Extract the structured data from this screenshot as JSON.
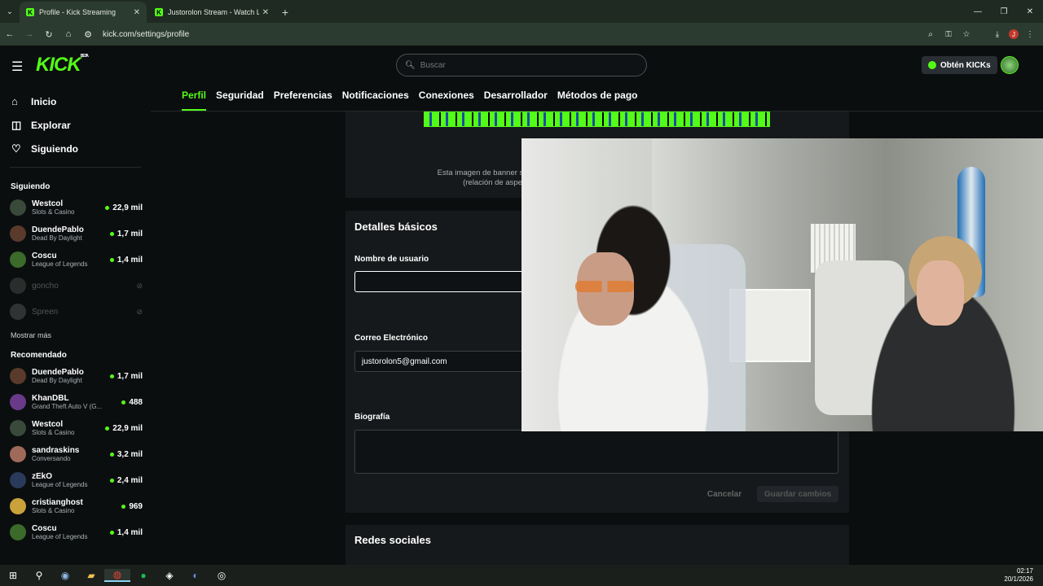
{
  "browser": {
    "tabs": [
      {
        "title": "Profile - Kick Streaming",
        "active": true
      },
      {
        "title": "Justorolon Stream - Watch Live",
        "active": false
      }
    ],
    "url": "kick.com/settings/profile"
  },
  "header": {
    "logo": "KICK",
    "logo_badge": "BETA",
    "search_placeholder": "Buscar",
    "kicks_button": "Obtén KICKs"
  },
  "sidebar": {
    "nav": [
      {
        "label": "Inicio",
        "icon": "home-icon"
      },
      {
        "label": "Explorar",
        "icon": "compass-icon"
      },
      {
        "label": "Siguiendo",
        "icon": "heart-icon"
      }
    ],
    "following_title": "Siguiendo",
    "following": [
      {
        "name": "Westcol",
        "category": "Slots & Casino",
        "viewers": "22,9 mil",
        "color": "#3a4a3a"
      },
      {
        "name": "DuendePablo",
        "category": "Dead By Daylight",
        "viewers": "1,7 mil",
        "color": "#5a3a2a"
      },
      {
        "name": "Coscu",
        "category": "League of Legends",
        "viewers": "1,4 mil",
        "color": "#3b6a2a"
      },
      {
        "name": "goncho",
        "category": "",
        "viewers": "",
        "color": "#666"
      },
      {
        "name": "Spreen",
        "category": "",
        "viewers": "",
        "color": "#777"
      }
    ],
    "show_more": "Mostrar más",
    "recommended_title": "Recomendado",
    "recommended": [
      {
        "name": "DuendePablo",
        "category": "Dead By Daylight",
        "viewers": "1,7 mil",
        "color": "#5a3a2a"
      },
      {
        "name": "KhanDBL",
        "category": "Grand Theft Auto V (G...",
        "viewers": "488",
        "color": "#6a3a8a"
      },
      {
        "name": "Westcol",
        "category": "Slots & Casino",
        "viewers": "22,9 mil",
        "color": "#3a4a3a"
      },
      {
        "name": "sandraskins",
        "category": "Conversando",
        "viewers": "3,2 mil",
        "color": "#a06a5a"
      },
      {
        "name": "zEkO",
        "category": "League of Legends",
        "viewers": "2,4 mil",
        "color": "#2a3a5a"
      },
      {
        "name": "cristianghost",
        "category": "Slots & Casino",
        "viewers": "969",
        "color": "#c9a23a"
      },
      {
        "name": "Coscu",
        "category": "League of Legends",
        "viewers": "1,4 mil",
        "color": "#3b6a2a"
      }
    ]
  },
  "settings_tabs": [
    "Perfil",
    "Seguridad",
    "Preferencias",
    "Notificaciones",
    "Conexiones",
    "Desarrollador",
    "Métodos de pago"
  ],
  "profile": {
    "banner_note_1": "Esta imagen de banner se mostrará dura",
    "banner_note_2": "(relación de aspecto 16:9)",
    "basic_title": "Detalles básicos",
    "username_label": "Nombre de usuario",
    "username_value": "",
    "email_label": "Correo Electrónico",
    "email_value": "justorolon5@gmail.com",
    "bio_label": "Biografía",
    "cancel": "Cancelar",
    "save": "Guardar cambios",
    "social_title": "Redes sociales"
  },
  "taskbar": {
    "time": "02:17",
    "date": "20/1/2026"
  },
  "colors": {
    "brand": "#53fc18",
    "bg": "#0b0e0f",
    "panel": "#16191b"
  }
}
